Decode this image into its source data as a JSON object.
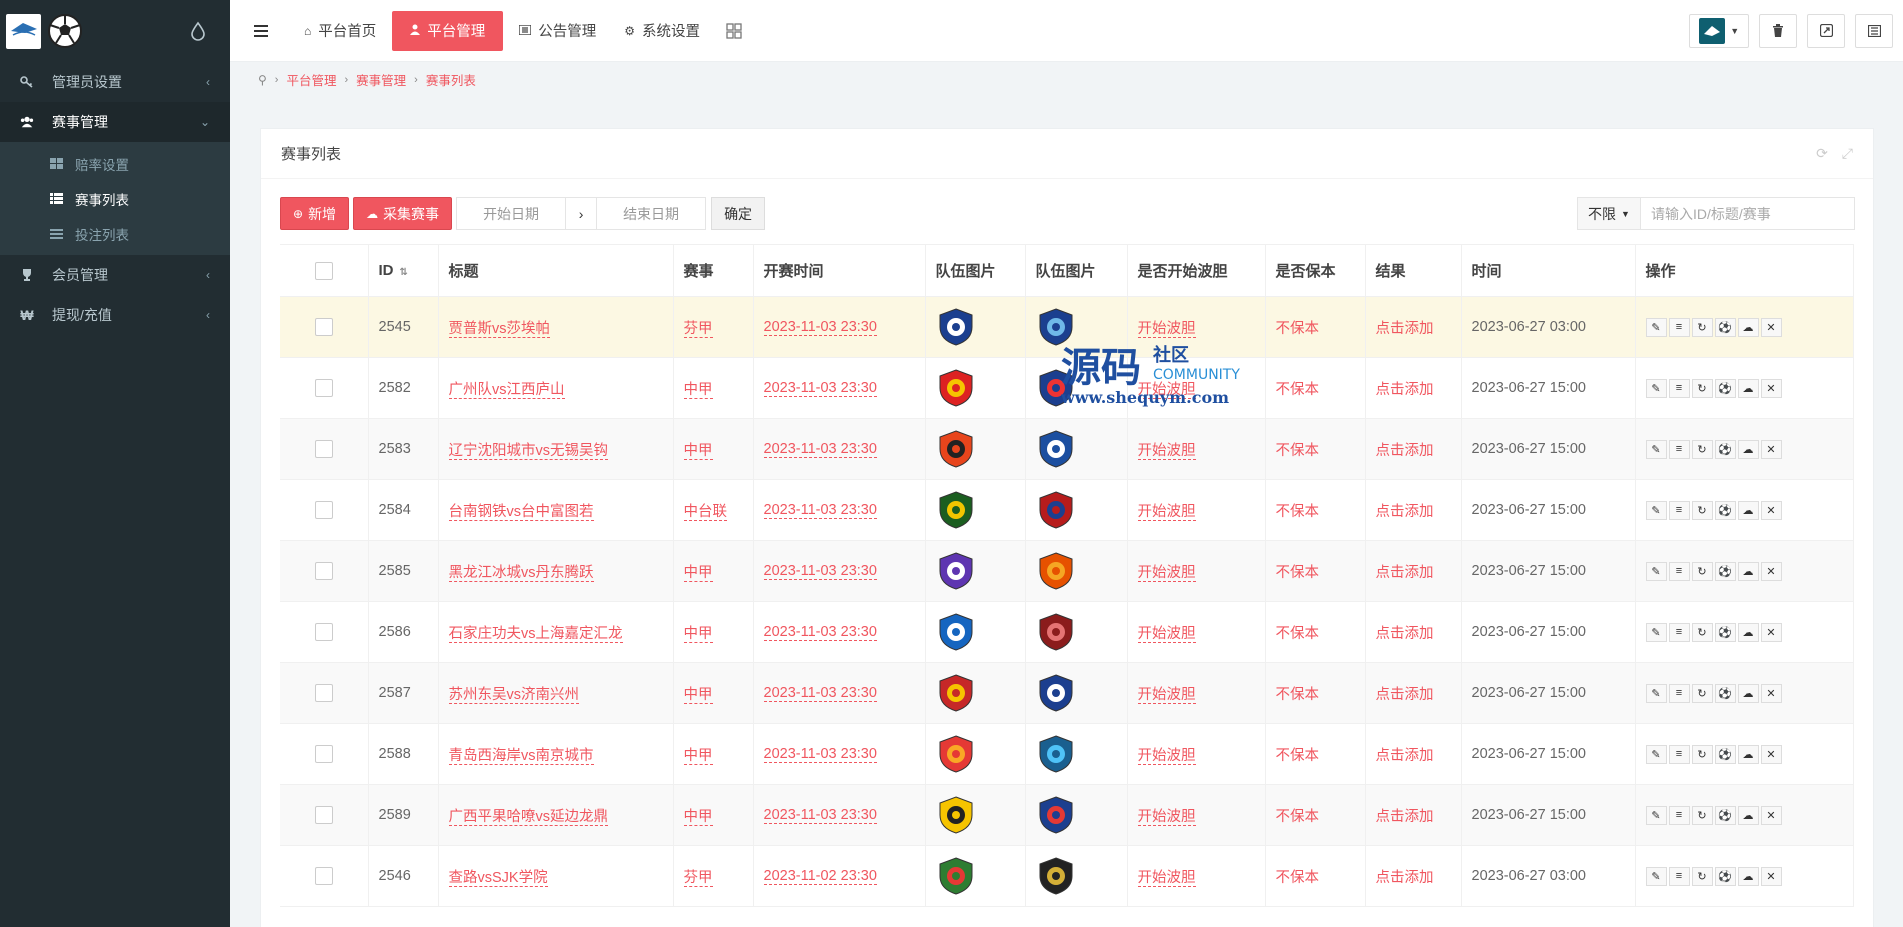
{
  "sidebar": {
    "items": [
      {
        "label": "管理员设置",
        "icon": "key-icon",
        "expanded": false
      },
      {
        "label": "赛事管理",
        "icon": "users-icon",
        "expanded": true,
        "children": [
          {
            "label": "赔率设置",
            "icon": "grid-icon"
          },
          {
            "label": "赛事列表",
            "icon": "table-icon",
            "active": true
          },
          {
            "label": "投注列表",
            "icon": "list-icon"
          }
        ]
      },
      {
        "label": "会员管理",
        "icon": "trophy-icon",
        "expanded": false
      },
      {
        "label": "提现/充值",
        "icon": "won-icon",
        "expanded": false
      }
    ]
  },
  "topbar": {
    "tabs": [
      {
        "label": "平台首页",
        "icon": "home-icon"
      },
      {
        "label": "平台管理",
        "icon": "user-icon",
        "active": true
      },
      {
        "label": "公告管理",
        "icon": "list-icon"
      },
      {
        "label": "系统设置",
        "icon": "gear-icon"
      }
    ]
  },
  "breadcrumb": [
    "平台管理",
    "赛事管理",
    "赛事列表"
  ],
  "panel": {
    "title": "赛事列表",
    "add_label": "新增",
    "collect_label": "采集赛事",
    "start_date_placeholder": "开始日期",
    "end_date_placeholder": "结束日期",
    "confirm_label": "确定",
    "filter_value": "不限",
    "search_placeholder": "请输入ID/标题/赛事"
  },
  "table": {
    "headers": [
      "ID",
      "标题",
      "赛事",
      "开赛时间",
      "队伍图片",
      "队伍图片",
      "是否开始波胆",
      "是否保本",
      "结果",
      "时间",
      "操作"
    ],
    "rows": [
      {
        "id": "2545",
        "title": "贾普斯vs莎埃帕",
        "league": "芬甲",
        "start": "2023-11-03 23:30",
        "bodan": "开始波胆",
        "baoben": "不保本",
        "result": "点击添加",
        "time": "2023-06-27 03:00"
      },
      {
        "id": "2582",
        "title": "广州队vs江西庐山",
        "league": "中甲",
        "start": "2023-11-03 23:30",
        "bodan": "开始波胆",
        "baoben": "不保本",
        "result": "点击添加",
        "time": "2023-06-27 15:00"
      },
      {
        "id": "2583",
        "title": "辽宁沈阳城市vs无锡吴钩",
        "league": "中甲",
        "start": "2023-11-03 23:30",
        "bodan": "开始波胆",
        "baoben": "不保本",
        "result": "点击添加",
        "time": "2023-06-27 15:00"
      },
      {
        "id": "2584",
        "title": "台南钢铁vs台中富图若",
        "league": "中台联",
        "start": "2023-11-03 23:30",
        "bodan": "开始波胆",
        "baoben": "不保本",
        "result": "点击添加",
        "time": "2023-06-27 15:00"
      },
      {
        "id": "2585",
        "title": "黑龙江冰城vs丹东腾跃",
        "league": "中甲",
        "start": "2023-11-03 23:30",
        "bodan": "开始波胆",
        "baoben": "不保本",
        "result": "点击添加",
        "time": "2023-06-27 15:00"
      },
      {
        "id": "2586",
        "title": "石家庄功夫vs上海嘉定汇龙",
        "league": "中甲",
        "start": "2023-11-03 23:30",
        "bodan": "开始波胆",
        "baoben": "不保本",
        "result": "点击添加",
        "time": "2023-06-27 15:00"
      },
      {
        "id": "2587",
        "title": "苏州东吴vs济南兴州",
        "league": "中甲",
        "start": "2023-11-03 23:30",
        "bodan": "开始波胆",
        "baoben": "不保本",
        "result": "点击添加",
        "time": "2023-06-27 15:00"
      },
      {
        "id": "2588",
        "title": "青岛西海岸vs南京城市",
        "league": "中甲",
        "start": "2023-11-03 23:30",
        "bodan": "开始波胆",
        "baoben": "不保本",
        "result": "点击添加",
        "time": "2023-06-27 15:00"
      },
      {
        "id": "2589",
        "title": "广西平果哈嘹vs延边龙鼎",
        "league": "中甲",
        "start": "2023-11-03 23:30",
        "bodan": "开始波胆",
        "baoben": "不保本",
        "result": "点击添加",
        "time": "2023-06-27 15:00"
      },
      {
        "id": "2546",
        "title": "查路vsSJK学院",
        "league": "芬甲",
        "start": "2023-11-02 23:30",
        "bodan": "开始波胆",
        "baoben": "不保本",
        "result": "点击添加",
        "time": "2023-06-27 03:00"
      }
    ]
  },
  "watermark": {
    "main": "源码",
    "sub": "社区",
    "en": "COMMUNITY",
    "url": "www.shequym.com"
  },
  "colors": {
    "accent": "#f0565f",
    "sidebar": "#222d32"
  }
}
